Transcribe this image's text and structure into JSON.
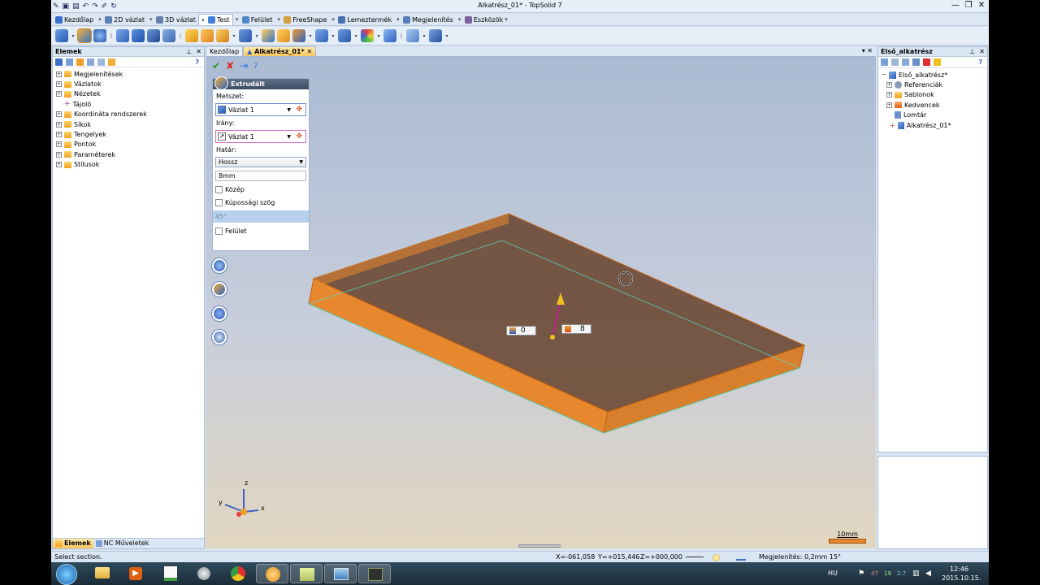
{
  "app": {
    "title": "Alkatrész_01* - TopSolid 7",
    "window_controls": [
      "—",
      "❐",
      "✕"
    ]
  },
  "ribbon": {
    "tabs": [
      {
        "label": "Kezdőlap",
        "color": "#3b6fc8"
      },
      {
        "label": "2D vázlat",
        "color": "#5a7fb8"
      },
      {
        "label": "3D vázlat",
        "color": "#6a7fa8"
      },
      {
        "label": "Test",
        "color": "#3f7fd8"
      },
      {
        "label": "Felület",
        "color": "#4f88c8"
      },
      {
        "label": "FreeShape",
        "color": "#d0a040"
      },
      {
        "label": "Lemeztermék",
        "color": "#4a6fb0"
      },
      {
        "label": "Megjelenítés",
        "color": "#5a80b8"
      },
      {
        "label": "Eszközök",
        "color": "#8060a0"
      }
    ],
    "active_tab": "Test"
  },
  "left_panel": {
    "title": "Elemek",
    "pin": "⊥",
    "close": "✕",
    "help": "?",
    "tree": [
      {
        "label": "Megjelenítések",
        "expandable": true
      },
      {
        "label": "Vázlatok",
        "expandable": true
      },
      {
        "label": "Nézetek",
        "expandable": true
      },
      {
        "label": "Tájoló",
        "expandable": false
      },
      {
        "label": "Koordináta rendszerek",
        "expandable": true
      },
      {
        "label": "Síkok",
        "expandable": true
      },
      {
        "label": "Tengelyek",
        "expandable": true
      },
      {
        "label": "Pontok",
        "expandable": true
      },
      {
        "label": "Paraméterek",
        "expandable": true
      },
      {
        "label": "Stílusok",
        "expandable": true
      }
    ],
    "bottom_tabs": [
      "Elemek",
      "NC Műveletek"
    ]
  },
  "document_tabs": [
    "Kezdőlap",
    "Alkatrész_01*"
  ],
  "active_document": "Alkatrész_01*",
  "property_panel": {
    "title": "Extrudált",
    "section_label": "Metszet:",
    "section_value": "Vázlat 1",
    "direction_label": "Irány:",
    "direction_value": "Vázlat 1",
    "limit_label": "Határ:",
    "limit_value": "Hossz",
    "length_value": "8mm",
    "checkboxes": [
      "Közép",
      "Kúpossági szög"
    ],
    "angle_value": "45°",
    "surface_checkbox": "Felület"
  },
  "viewport": {
    "label_start": "0",
    "label_length": "8",
    "scale": "10mm",
    "axes": {
      "x": "x",
      "y": "y",
      "z": "z"
    },
    "solid_color": "#e8882e"
  },
  "right_panel": {
    "title": "Első_alkatrész",
    "pin": "⊥",
    "close": "✕",
    "tree": [
      {
        "label": "Első_alkatrész*",
        "level": 0
      },
      {
        "label": "Referenciák",
        "level": 1
      },
      {
        "label": "Sablonok",
        "level": 1
      },
      {
        "label": "Kedvencek",
        "level": 1
      },
      {
        "label": "Lomtár",
        "level": 1
      },
      {
        "label": "Alkatrész_01*",
        "level": 1
      }
    ]
  },
  "status_bar": {
    "message": "Select section.",
    "x": "X=-061,058",
    "y": "Y=+015,446",
    "z": "Z=+000,000",
    "display": "Megjelenítés: 0,2mm 15°"
  },
  "taskbar": {
    "lang": "HU",
    "time": "12:46",
    "date": "2015.10.15.",
    "tray_numbers": [
      "47",
      "19",
      "2.7"
    ]
  }
}
